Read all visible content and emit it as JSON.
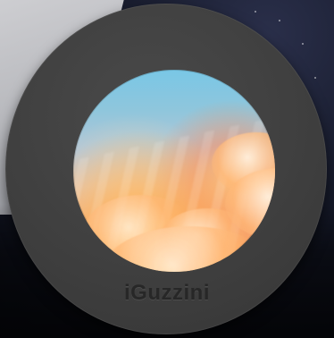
{
  "brand": {
    "name": "iGuzzini"
  },
  "scene": {
    "device_color": "#404040",
    "brand_text_color": "#272727"
  },
  "icons": {
    "sky_image": "sunset-sky-image"
  }
}
